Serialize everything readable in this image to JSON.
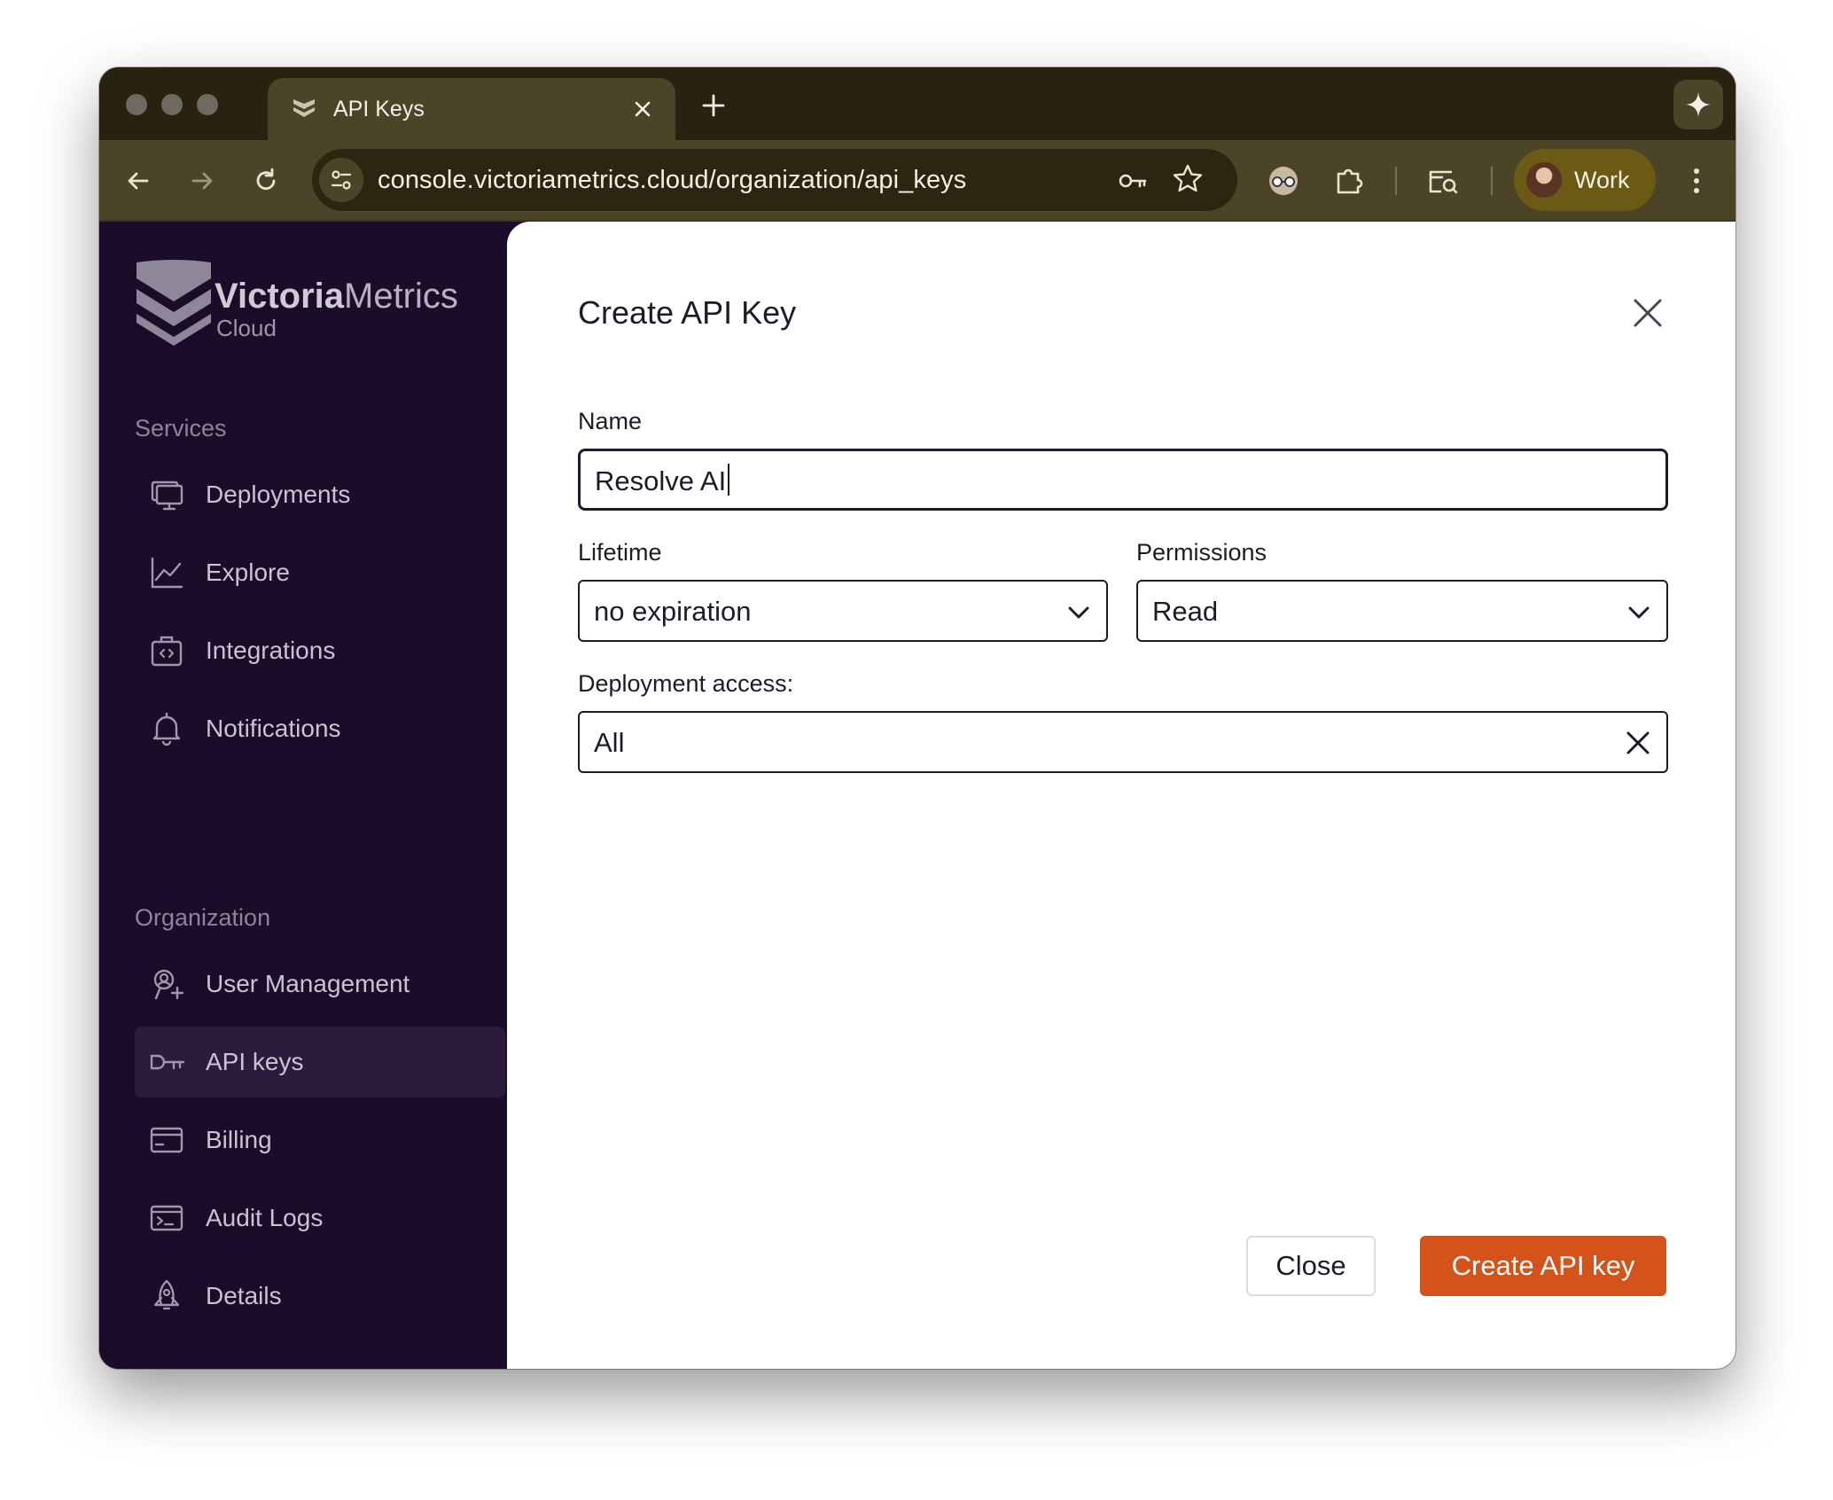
{
  "browser": {
    "tab_title": "API Keys",
    "url": "console.victoriametrics.cloud/organization/api_keys",
    "profile_label": "Work"
  },
  "logo": {
    "word_bold": "Victoria",
    "word_regular": "Metrics",
    "sub": "Cloud"
  },
  "sidebar": {
    "services_label": "Services",
    "services_items": [
      {
        "label": "Deployments",
        "icon": "monitor-icon"
      },
      {
        "label": "Explore",
        "icon": "line-chart-icon"
      },
      {
        "label": "Integrations",
        "icon": "code-briefcase-icon"
      },
      {
        "label": "Notifications",
        "icon": "bell-icon"
      }
    ],
    "organization_label": "Organization",
    "organization_items": [
      {
        "label": "User Management",
        "icon": "user-plus-icon"
      },
      {
        "label": "API keys",
        "icon": "key-icon",
        "active": true
      },
      {
        "label": "Billing",
        "icon": "card-icon"
      },
      {
        "label": "Audit Logs",
        "icon": "terminal-icon"
      },
      {
        "label": "Details",
        "icon": "rocket-icon"
      }
    ]
  },
  "dialog": {
    "title": "Create API Key",
    "name_label": "Name",
    "name_value": "Resolve AI",
    "lifetime_label": "Lifetime",
    "lifetime_value": "no expiration",
    "permissions_label": "Permissions",
    "permissions_value": "Read",
    "deployment_label": "Deployment access:",
    "deployment_value": "All",
    "close_button": "Close",
    "create_button": "Create API key"
  },
  "colors": {
    "sidebar_bg": "#1b0c29",
    "accent": "#d4531b",
    "browser_chrome": "#4b4426"
  }
}
